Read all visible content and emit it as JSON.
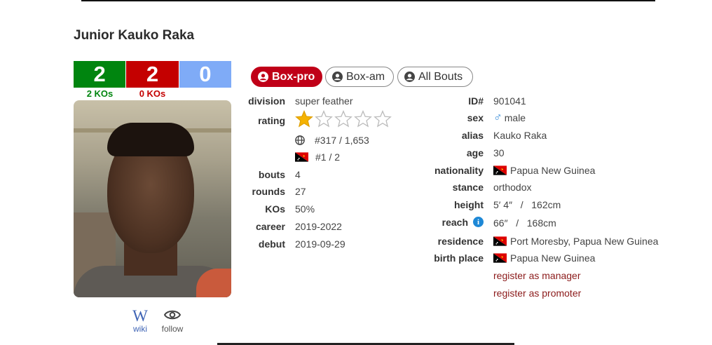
{
  "boxer_name": "Junior Kauko Raka",
  "record": {
    "wins": "2",
    "losses": "2",
    "draws": "0",
    "win_kos": "2 KOs",
    "loss_kos": "0 KOs"
  },
  "links": {
    "wiki": "wiki",
    "wiki_glyph": "W",
    "follow": "follow"
  },
  "tabs": [
    {
      "label": "Box-pro",
      "active": true
    },
    {
      "label": "Box-am",
      "active": false
    },
    {
      "label": "All Bouts",
      "active": false
    }
  ],
  "stats": {
    "division_label": "division",
    "division": "super feather",
    "rating_label": "rating",
    "rating_stars": 1,
    "rating_max": 5,
    "world_rank": "#317 / 1,653",
    "country_rank": "#1 / 2",
    "bouts_label": "bouts",
    "bouts": "4",
    "rounds_label": "rounds",
    "rounds": "27",
    "kos_label": "KOs",
    "kos": "50%",
    "career_label": "career",
    "career": "2019-2022",
    "debut_label": "debut",
    "debut": "2019-09-29"
  },
  "bio": {
    "id_label": "ID#",
    "id": "901041",
    "sex_label": "sex",
    "sex": "male",
    "alias_label": "alias",
    "alias": "Kauko Raka",
    "age_label": "age",
    "age": "30",
    "nationality_label": "nationality",
    "nationality": "Papua New Guinea",
    "stance_label": "stance",
    "stance": "orthodox",
    "height_label": "height",
    "height": "5′ 4″   /   162cm",
    "reach_label": "reach",
    "reach": "66″   /   168cm",
    "residence_label": "residence",
    "residence": "Port Moresby, Papua New Guinea",
    "birthplace_label": "birth place",
    "birthplace": "Papua New Guinea",
    "register_manager": "register as manager",
    "register_promoter": "register as promoter"
  },
  "colors": {
    "win": "#00850f",
    "loss": "#c40000",
    "draw": "#7fabf7",
    "active_tab": "#c00018",
    "link": "#8b1a1a"
  }
}
